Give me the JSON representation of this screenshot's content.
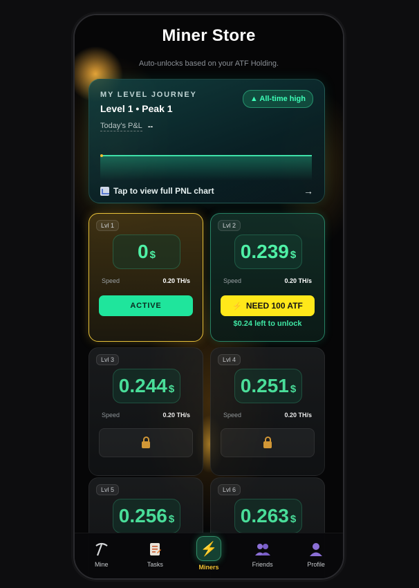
{
  "header": {
    "title": "Miner Store",
    "subtitle": "Auto-unlocks based on your ATF Holding."
  },
  "journey": {
    "label": "MY LEVEL JOURNEY",
    "level_text": "Level 1 • Peak 1",
    "badge": "▲ All-time high",
    "pnl_label": "Today's P&L",
    "pnl_value": "--",
    "view_chart": "Tap to view full PNL chart",
    "arrow": "→"
  },
  "miners": [
    {
      "level": "Lvl 1",
      "value": "0",
      "currency": "$",
      "speed_label": "Speed",
      "speed": "0.20 TH/s",
      "status": "active",
      "button": "ACTIVE"
    },
    {
      "level": "Lvl 2",
      "value": "0.239",
      "currency": "$",
      "speed_label": "Speed",
      "speed": "0.20 TH/s",
      "status": "unlockable",
      "button": "NEED 100 ATF",
      "note": "$0.24 left to unlock"
    },
    {
      "level": "Lvl 3",
      "value": "0.244",
      "currency": "$",
      "speed_label": "Speed",
      "speed": "0.20 TH/s",
      "status": "locked"
    },
    {
      "level": "Lvl 4",
      "value": "0.251",
      "currency": "$",
      "speed_label": "Speed",
      "speed": "0.20 TH/s",
      "status": "locked"
    },
    {
      "level": "Lvl 5",
      "value": "0.256",
      "currency": "$",
      "status": "locked"
    },
    {
      "level": "Lvl 6",
      "value": "0.263",
      "currency": "$",
      "status": "locked"
    }
  ],
  "nav": {
    "items": [
      {
        "label": "Mine",
        "icon": "pickaxe-icon"
      },
      {
        "label": "Tasks",
        "icon": "tasks-icon"
      },
      {
        "label": "Miners",
        "icon": "bolt-icon",
        "current": true
      },
      {
        "label": "Friends",
        "icon": "friends-icon"
      },
      {
        "label": "Profile",
        "icon": "profile-icon"
      }
    ]
  },
  "colors": {
    "accent_green": "#4ff0a6",
    "active_button": "#1fe59c",
    "need_button": "#ffe81a",
    "active_border": "#e8c23a",
    "nav_current": "#f1c232"
  }
}
